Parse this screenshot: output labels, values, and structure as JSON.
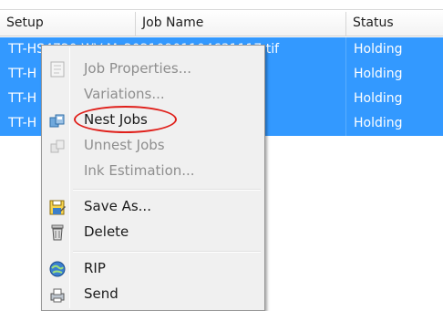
{
  "table": {
    "columns": [
      "Setup",
      "Job Name",
      "Status"
    ],
    "rows": [
      {
        "name_text": "TT-HS4720-WV-M_20210901104631117.tif",
        "status": "Holding"
      },
      {
        "name_text": "TT-H",
        "status": "Holding"
      },
      {
        "name_text": "TT-H",
        "status": "Holding"
      },
      {
        "name_text": "TT-H",
        "status": "Holding"
      }
    ]
  },
  "context_menu": {
    "items": [
      {
        "label": "Job Properties...",
        "enabled": false,
        "icon": "job-properties-icon"
      },
      {
        "label": "Variations...",
        "enabled": false,
        "icon": ""
      },
      {
        "label": "Nest Jobs",
        "enabled": true,
        "icon": "nest-jobs-icon",
        "highlighted_by_annotation": true
      },
      {
        "label": "Unnest Jobs",
        "enabled": false,
        "icon": "unnest-jobs-icon"
      },
      {
        "label": "Ink Estimation...",
        "enabled": false,
        "icon": ""
      },
      {
        "label": "Save As...",
        "enabled": true,
        "icon": "save-as-icon"
      },
      {
        "label": "Delete",
        "enabled": true,
        "icon": "delete-icon"
      },
      {
        "label": "RIP",
        "enabled": true,
        "icon": "rip-icon"
      },
      {
        "label": "Send",
        "enabled": true,
        "icon": "send-icon"
      }
    ]
  },
  "colors": {
    "selection": "#3399ff",
    "annotation": "#e0201b",
    "menu_background": "#f0f0f0"
  }
}
